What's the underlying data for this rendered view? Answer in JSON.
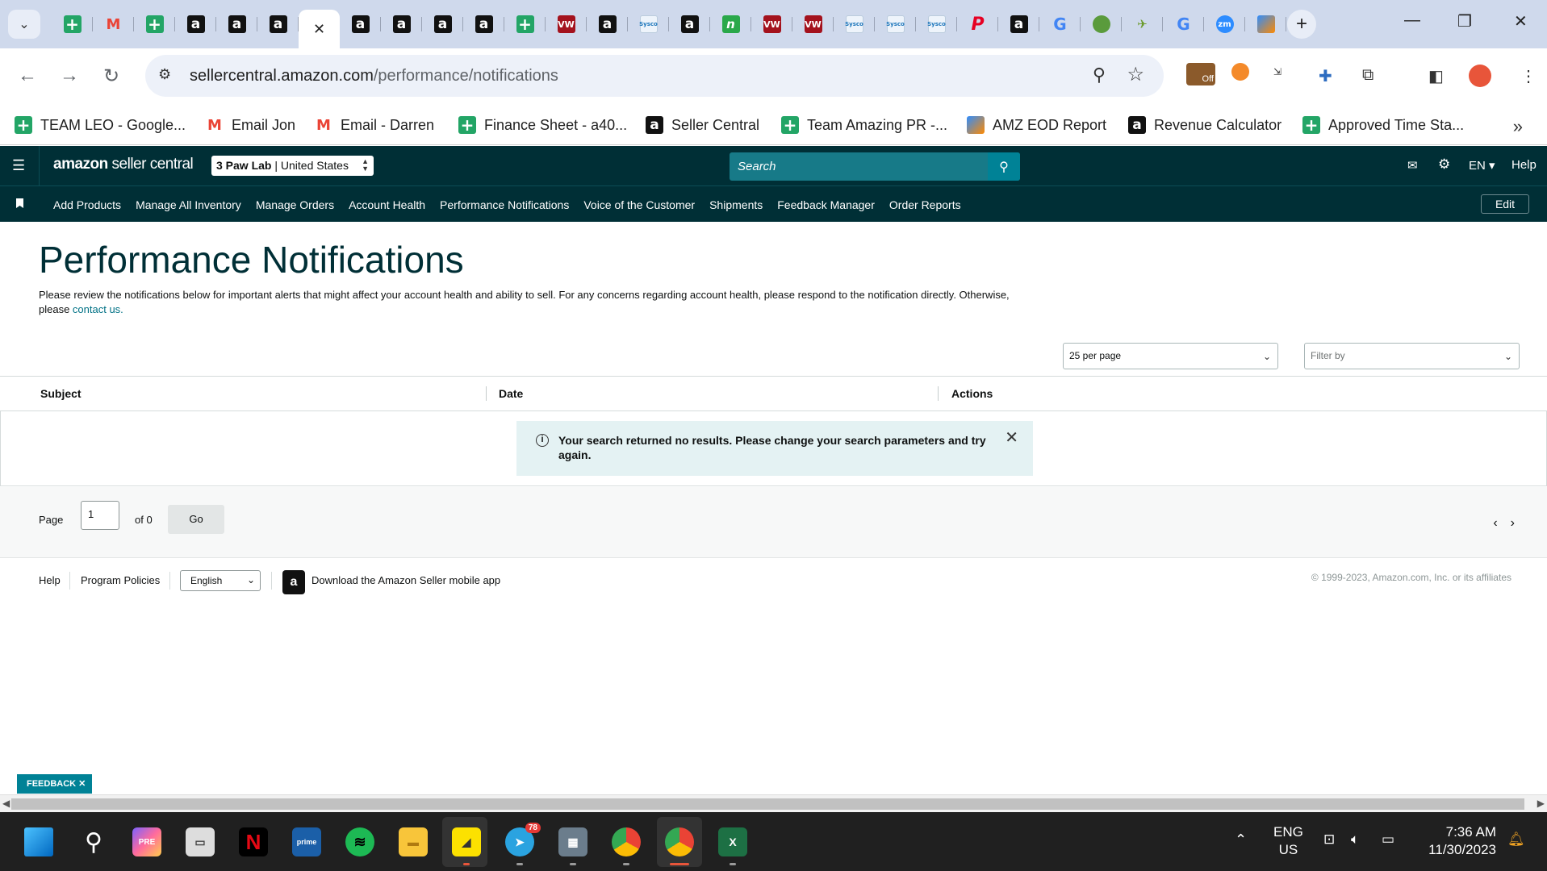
{
  "browser": {
    "tabs": [
      {
        "icon": "google-sheets-icon",
        "glyph": "+"
      },
      {
        "icon": "gmail-icon",
        "glyph": "M"
      },
      {
        "icon": "google-sheets-icon",
        "glyph": "+"
      },
      {
        "icon": "amazon-icon",
        "glyph": "a"
      },
      {
        "icon": "amazon-icon",
        "glyph": "a"
      },
      {
        "icon": "amazon-icon",
        "glyph": "a"
      },
      {
        "icon": "close-icon",
        "glyph": "✕",
        "active": true
      },
      {
        "icon": "amazon-icon",
        "glyph": "a"
      },
      {
        "icon": "amazon-icon",
        "glyph": "a"
      },
      {
        "icon": "amazon-icon",
        "glyph": "a"
      },
      {
        "icon": "amazon-icon",
        "glyph": "a"
      },
      {
        "icon": "google-sheets-icon",
        "glyph": "+"
      },
      {
        "icon": "vw-icon",
        "glyph": "VW"
      },
      {
        "icon": "amazon-icon",
        "glyph": "a"
      },
      {
        "icon": "sysco-icon",
        "glyph": "Sysco"
      },
      {
        "icon": "amazon-icon",
        "glyph": "a"
      },
      {
        "icon": "n-icon",
        "glyph": "n"
      },
      {
        "icon": "vw-icon",
        "glyph": "VW"
      },
      {
        "icon": "vw-icon",
        "glyph": "VW"
      },
      {
        "icon": "sysco-icon",
        "glyph": "Sysco"
      },
      {
        "icon": "sysco-icon",
        "glyph": "Sysco"
      },
      {
        "icon": "sysco-icon",
        "glyph": "Sysco"
      },
      {
        "icon": "pinterest-icon",
        "glyph": "P"
      },
      {
        "icon": "amazon-icon",
        "glyph": "a"
      },
      {
        "icon": "google-icon",
        "glyph": "G"
      },
      {
        "icon": "globe-icon",
        "glyph": ""
      },
      {
        "icon": "bird-icon",
        "glyph": "✈"
      },
      {
        "icon": "google-icon",
        "glyph": "G"
      },
      {
        "icon": "zoom-icon",
        "glyph": "zm"
      },
      {
        "icon": "eod-icon",
        "glyph": ""
      }
    ],
    "url_domain": "sellercentral.amazon.com",
    "url_path": "/performance/notifications",
    "bookmarks": [
      {
        "label": "TEAM LEO - Google...",
        "icon": "google-sheets-icon",
        "glyph": "+"
      },
      {
        "label": "Email Jon",
        "icon": "gmail-icon",
        "glyph": "M"
      },
      {
        "label": "Email - Darren",
        "icon": "gmail-icon",
        "glyph": "M"
      },
      {
        "label": "Finance Sheet - a40...",
        "icon": "google-sheets-icon",
        "glyph": "+"
      },
      {
        "label": "Seller Central",
        "icon": "amazon-icon",
        "glyph": "a"
      },
      {
        "label": "Team Amazing PR -...",
        "icon": "google-sheets-icon",
        "glyph": "+"
      },
      {
        "label": "AMZ EOD Report",
        "icon": "eod-icon",
        "glyph": ""
      },
      {
        "label": "Revenue Calculator",
        "icon": "amazon-icon",
        "glyph": "a"
      },
      {
        "label": "Approved Time Sta...",
        "icon": "google-sheets-icon",
        "glyph": "+"
      }
    ],
    "ext_badge": "Off"
  },
  "header": {
    "logo_bold": "amazon",
    "logo_thin": " seller central",
    "store_name": "3 Paw Lab",
    "store_region": "United States",
    "search_placeholder": "Search",
    "language": "EN",
    "help": "Help"
  },
  "nav": {
    "links": [
      "Add Products",
      "Manage All Inventory",
      "Manage Orders",
      "Account Health",
      "Performance Notifications",
      "Voice of the Customer",
      "Shipments",
      "Feedback Manager",
      "Order Reports"
    ],
    "edit": "Edit"
  },
  "main": {
    "title": "Performance Notifications",
    "description": "Please review the notifications below for important alerts that might affect your account health and ability to sell. For any concerns regarding account health, please respond to the notification directly. Otherwise, please ",
    "contact_link": "contact us.",
    "per_page": "25 per page",
    "filter_placeholder": "Filter by",
    "columns": [
      "Subject",
      "Date",
      "Actions"
    ],
    "no_results": "Your search returned no results. Please change your search parameters and try again.",
    "pager": {
      "label": "Page",
      "value": "1",
      "of": "of 0",
      "go": "Go"
    }
  },
  "footer": {
    "help": "Help",
    "policies": "Program Policies",
    "language": "English",
    "app_text": "Download the Amazon Seller mobile app",
    "copyright": "© 1999-2023, Amazon.com, Inc. or its affiliates"
  },
  "feedback": "FEEDBACK",
  "taskbar": {
    "lang_top": "ENG",
    "lang_bottom": "US",
    "time": "7:36 AM",
    "date": "11/30/2023",
    "telegram_badge": "78"
  }
}
